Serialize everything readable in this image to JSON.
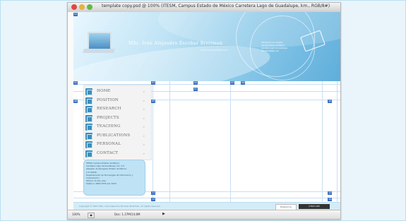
{
  "window": {
    "title": "template copy.psd @ 100% (ITESM, Campus Estado de México Carretera Lago de Guadalupe, km., RGB/8#)"
  },
  "header": {
    "author": "MSc. Iván Alejandro Escobar Broitman",
    "url": "www.ivanescobar.com",
    "info_lines": [
      "Información de contacto",
      "Campus Estado de México",
      "Carretera Lago de Guadalupe",
      "iescobar@itesm.mx"
    ]
  },
  "nav": {
    "items": [
      {
        "label": "HOME"
      },
      {
        "label": "POSITION"
      },
      {
        "label": "RESEARCH"
      },
      {
        "label": "PROJECTS"
      },
      {
        "label": "TEACHING"
      },
      {
        "label": "PUBLICATIONS"
      },
      {
        "label": "PERSONAL"
      },
      {
        "label": "CONTACT"
      }
    ]
  },
  "address": {
    "lines": [
      "ITESM, Campus Estado de México",
      "Carretera Lago de Guadalupe, km. 3.5,",
      "Atizapán de Zaragoza, Estado de México,",
      "C.P. 52926",
      "Departamento de Tecnologías de Información y",
      "Computación",
      "Oficina: CI-2do. piso",
      "Teléfono: 5864 5555 ext. 5523"
    ]
  },
  "footer": {
    "copyright": "Copyright © 2007 MSc. Iván Alejandro Escobar Broitman. All rights reserved",
    "badge_left": "Powered by",
    "badge_right": "ITESM CEM"
  },
  "statusbar": {
    "zoom": "100%",
    "doc_size": "Doc: 1.37M/14.8M"
  },
  "slices": [
    "01",
    "02",
    "03",
    "04",
    "05",
    "06",
    "07",
    "08",
    "09",
    "10",
    "11",
    "12",
    "13",
    "14",
    "15"
  ]
}
